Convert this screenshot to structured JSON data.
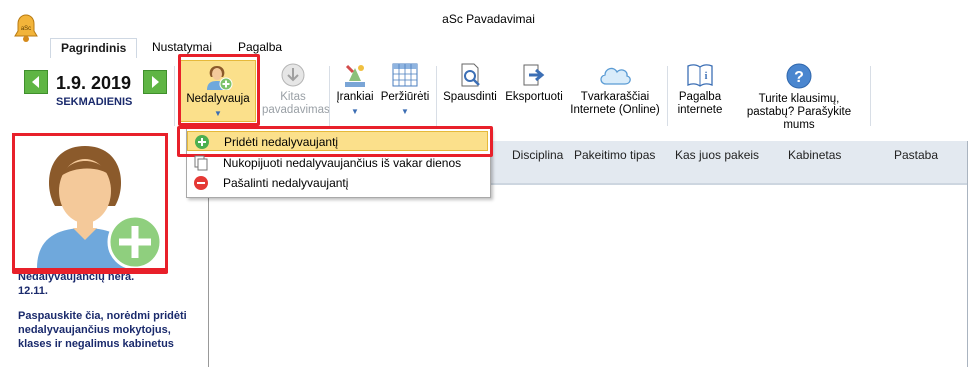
{
  "window": {
    "title": "aSc Pavadavimai"
  },
  "tabs": [
    {
      "label": "Pagrindinis",
      "active": true
    },
    {
      "label": "Nustatymai",
      "active": false
    },
    {
      "label": "Pagalba",
      "active": false
    }
  ],
  "date": {
    "value": "1.9. 2019",
    "day": "SEKMADIENIS"
  },
  "ribbon": {
    "absent": "Nedalyvauja",
    "copy_line1": "Kitas",
    "copy_line2": "pavadavimas",
    "tools": "Įrankiai",
    "views": "Peržiūrėti",
    "print": "Spausdinti",
    "export": "Eksportuoti",
    "online_line1": "Tvarkaraščiai",
    "online_line2": "Internete (Online)",
    "help_line1": "Pagalba",
    "help_line2": "internete",
    "question_line1": "Turite klausimų,",
    "question_line2": "pastabų? Parašykite mums"
  },
  "menu": {
    "items": [
      {
        "label": "Pridėti nedalyvaujantį",
        "icon": "add-icon"
      },
      {
        "label": "Nukopijuoti nedalyvaujančius iš vakar dienos",
        "icon": "copy-icon"
      },
      {
        "label": "Pašalinti nedalyvaujantį",
        "icon": "remove-icon"
      }
    ]
  },
  "grid": {
    "columns": [
      "Disciplina",
      "Pakeitimo tipas",
      "Kas juos pakeis",
      "Kabinetas",
      "Pastaba"
    ]
  },
  "left": {
    "line1": "Nedalyvaujančių nėra.",
    "line2": "12.11.",
    "line3": "Paspauskite čia, norėdmi pridėti nedalyvaujančius mokytojus, klases ir negalimus kabinetus"
  },
  "colors": {
    "accent": "#e8202a",
    "green": "#5fb544",
    "highlight": "#fbe08b"
  }
}
